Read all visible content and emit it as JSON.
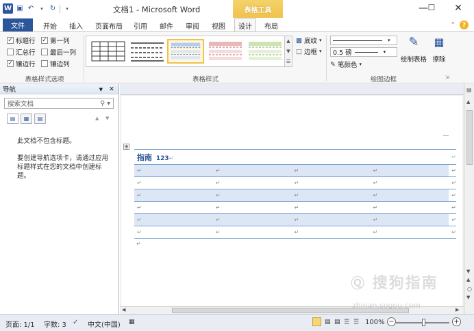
{
  "window": {
    "title": "文档1 - Microsoft Word",
    "context_tab": "表格工具",
    "controls": [
      "—",
      "☐",
      "✕"
    ]
  },
  "tabs": [
    {
      "label": "文件"
    },
    {
      "label": "开始"
    },
    {
      "label": "插入"
    },
    {
      "label": "页面布局"
    },
    {
      "label": "引用"
    },
    {
      "label": "邮件"
    },
    {
      "label": "审阅"
    },
    {
      "label": "视图"
    },
    {
      "label": "设计"
    },
    {
      "label": "布局"
    }
  ],
  "ribbon": {
    "options_group": {
      "label": "表格样式选项",
      "items": [
        {
          "label": "标题行",
          "checked": true
        },
        {
          "label": "第一列",
          "checked": true
        },
        {
          "label": "汇总行",
          "checked": false
        },
        {
          "label": "最后一列",
          "checked": false
        },
        {
          "label": "镶边行",
          "checked": true
        },
        {
          "label": "镶边列",
          "checked": false
        }
      ]
    },
    "styles_group": {
      "label": "表格样式"
    },
    "shading_label": "底纹",
    "border_label": "边框",
    "draw_group": {
      "label": "绘图边框",
      "line_weight": "0.5 磅",
      "pen_color": "笔颜色",
      "draw_table": "绘制表格",
      "eraser": "擦除"
    }
  },
  "nav": {
    "title": "导航",
    "search_placeholder": "搜索文档",
    "msg1": "此文档不包含标题。",
    "msg2": "要创建导航选项卡，请通过应用标题样式在您的文档中创建标题。"
  },
  "document": {
    "header_text": "指南",
    "header_num": "123"
  },
  "status": {
    "page": "页面: 1/1",
    "words": "字数: 3",
    "lang": "中文(中国)",
    "zoom": "100%",
    "zoom_level_percent": 100
  },
  "watermark": {
    "text": "搜狗指南",
    "url": "zhinan.sogou.com"
  },
  "colors": {
    "accent": "#2b579a",
    "context_tab": "#f0c24a",
    "table_band": "#dce6f4",
    "table_border": "#7ba0d4"
  }
}
